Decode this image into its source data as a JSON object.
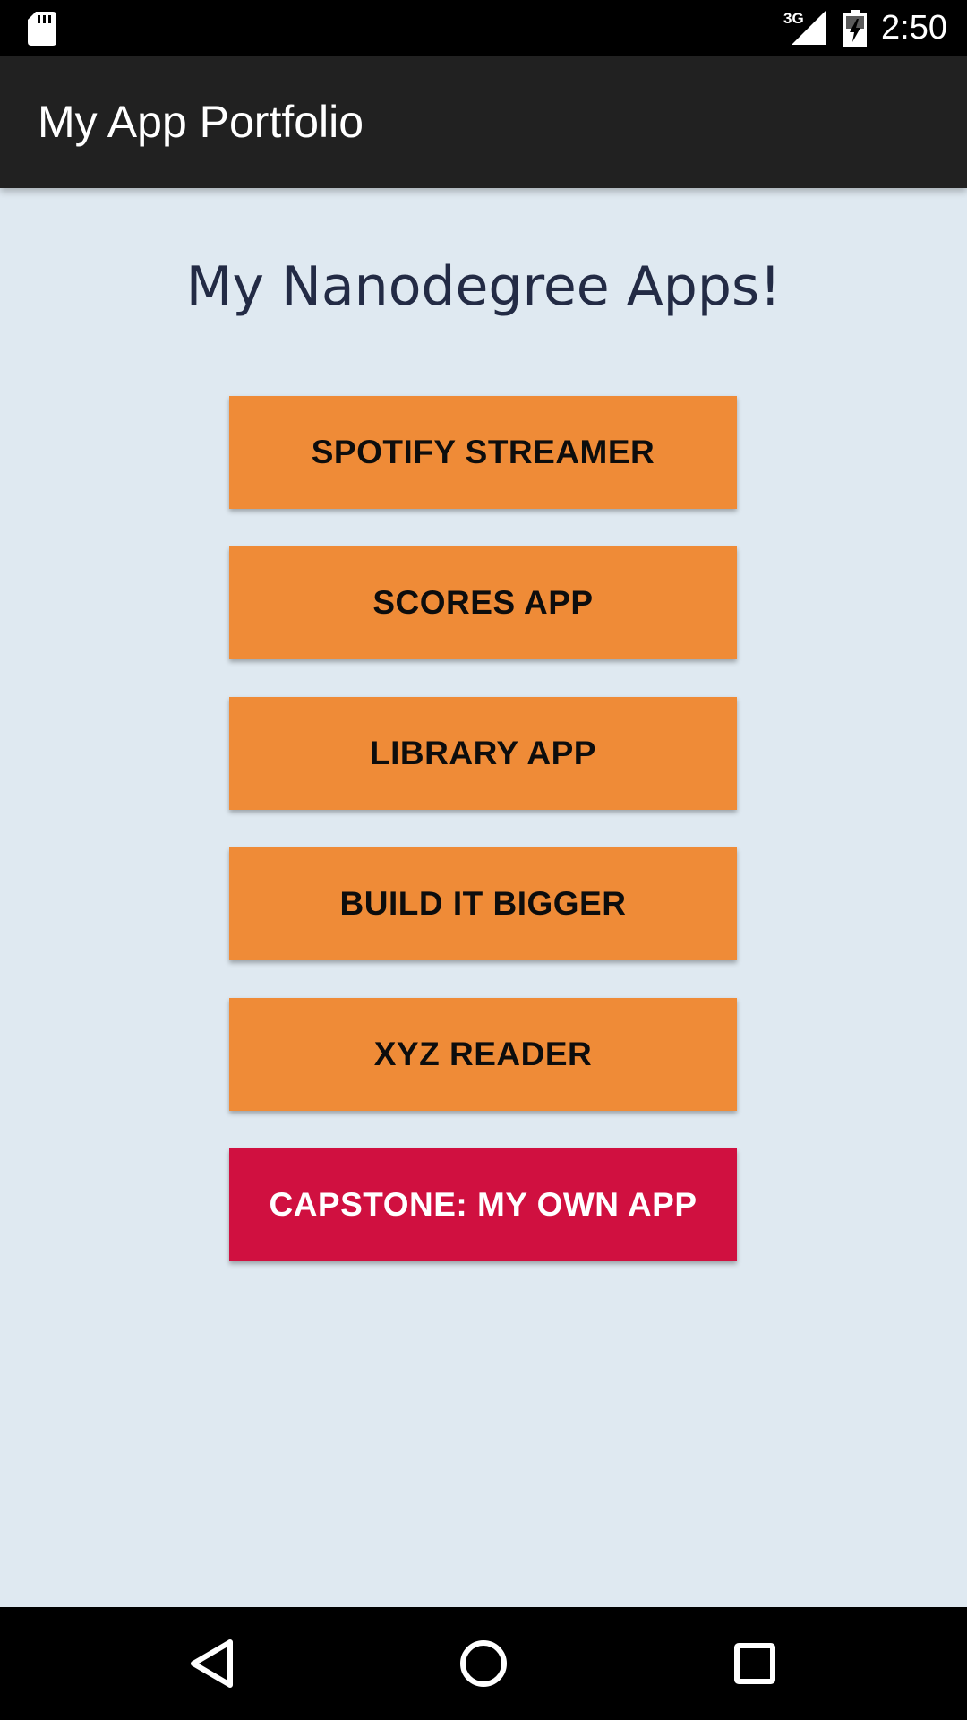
{
  "status_bar": {
    "network": "3G",
    "time": "2:50",
    "icons": [
      "sd-card-icon",
      "signal-icon",
      "battery-charging-icon"
    ]
  },
  "app_bar": {
    "title": "My App Portfolio"
  },
  "main": {
    "heading": "My Nanodegree Apps!",
    "buttons": [
      {
        "label": "SPOTIFY STREAMER"
      },
      {
        "label": "SCORES APP"
      },
      {
        "label": "LIBRARY APP"
      },
      {
        "label": "BUILD IT BIGGER"
      },
      {
        "label": "XYZ READER"
      },
      {
        "label": "CAPSTONE: MY OWN APP"
      }
    ]
  },
  "nav_bar": {
    "icons": [
      "back-icon",
      "home-icon",
      "recents-icon"
    ]
  },
  "colors": {
    "background": "#dfe9f1",
    "app_bar": "#212121",
    "button_orange": "#ef8b37",
    "button_red": "#d01040",
    "heading_text": "#232b45"
  }
}
